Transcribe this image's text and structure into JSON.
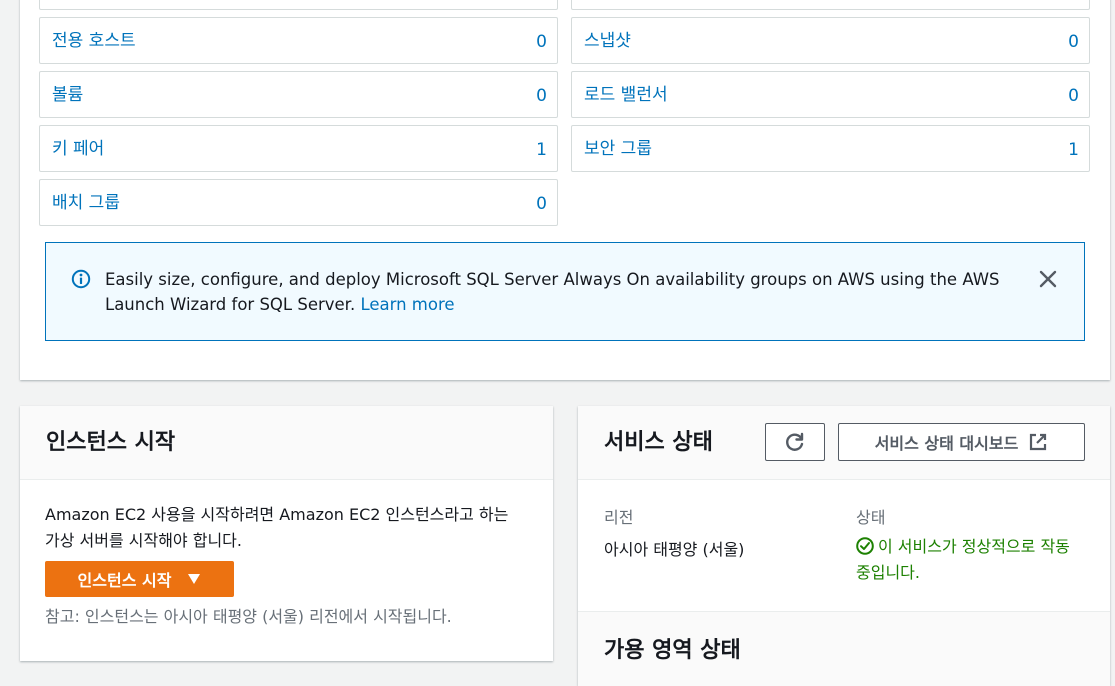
{
  "resources": [
    {
      "label": "전용 호스트",
      "count": "0"
    },
    {
      "label": "스냅샷",
      "count": "0"
    },
    {
      "label": "볼륨",
      "count": "0"
    },
    {
      "label": "로드 밸런서",
      "count": "0"
    },
    {
      "label": "키 페어",
      "count": "1"
    },
    {
      "label": "보안 그룹",
      "count": "1"
    },
    {
      "label": "배치 그룹",
      "count": "0"
    }
  ],
  "flash": {
    "text": "Easily size, configure, and deploy Microsoft SQL Server Always On availability groups on AWS using the AWS Launch Wizard for SQL Server.",
    "link": "Learn more",
    "icon": "info-icon",
    "close_icon": "close-icon"
  },
  "launch": {
    "title": "인스턴스 시작",
    "description": "Amazon EC2 사용을 시작하려면 Amazon EC2 인스턴스라고 하는 가상 서버를 시작해야 합니다.",
    "button": "인스턴스 시작",
    "button_icon": "caret-down-icon",
    "note": "참고: 인스턴스는 아시아 태평양 (서울) 리전에서 시작됩니다."
  },
  "health": {
    "title": "서비스 상태",
    "refresh_icon": "refresh-icon",
    "dashboard_button": "서비스 상태 대시보드",
    "dashboard_icon": "external-link-icon",
    "region_label": "리전",
    "region_value": "아시아 태평양 (서울)",
    "status_label": "상태",
    "status_value": "이 서비스가 정상적으로 작동 중입니다.",
    "status_icon": "status-ok-icon",
    "az_title": "가용 영역 상태"
  },
  "colors": {
    "link": "#0073bb",
    "primary_button": "#ec7211",
    "success": "#1d8102",
    "info_border": "#0073bb",
    "info_bg": "#f1faff"
  }
}
